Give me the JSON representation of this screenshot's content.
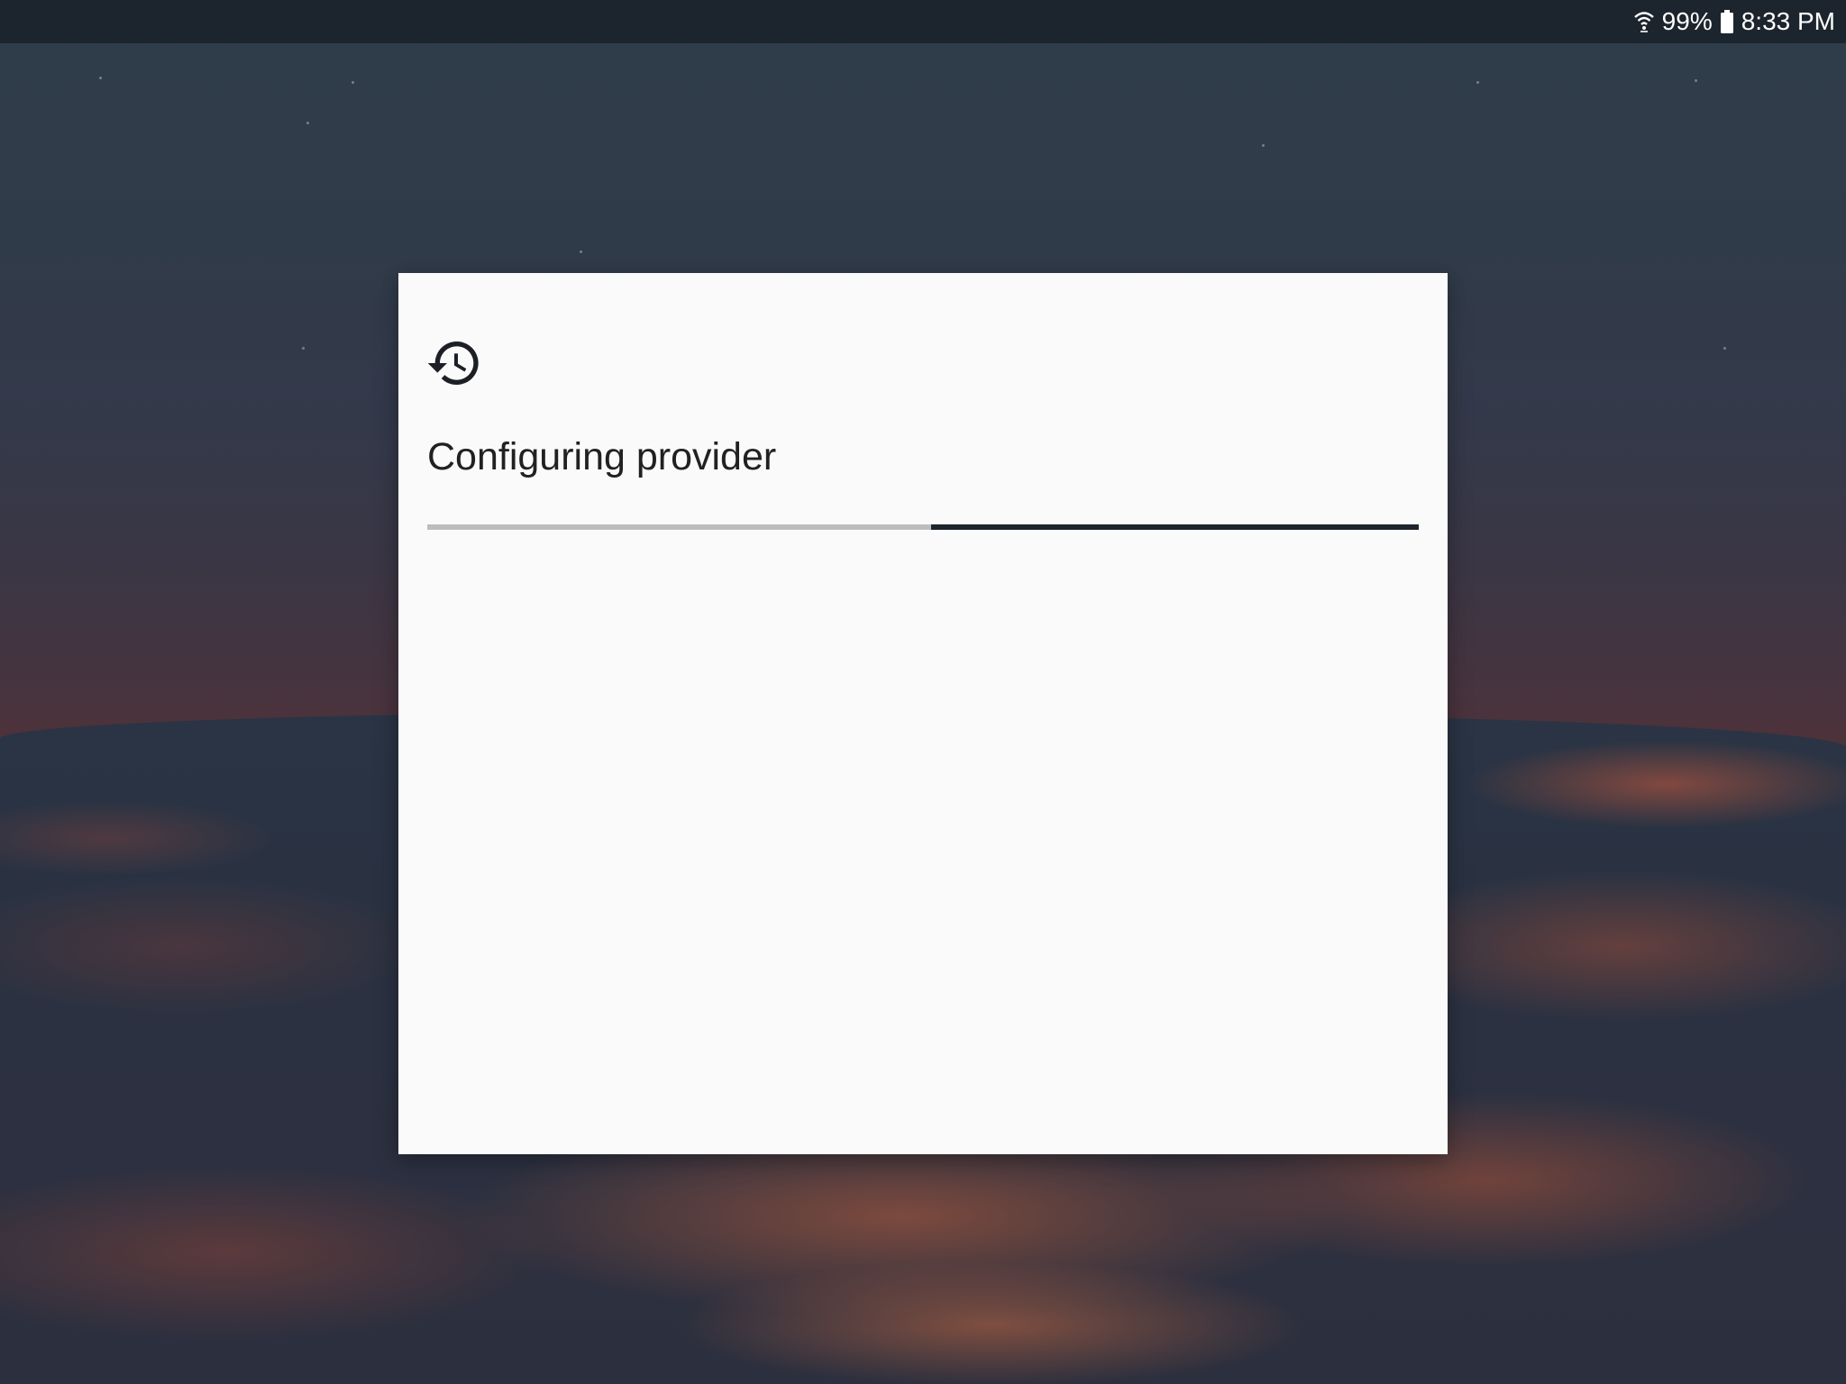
{
  "status_bar": {
    "wifi_icon": "wifi-icon",
    "battery_percent": "99%",
    "battery_icon": "battery-icon",
    "time": "8:33 PM"
  },
  "dialog": {
    "icon": "history-restore-icon",
    "title": "Configuring provider",
    "progress": {
      "type": "indeterminate",
      "indicator_start_fraction": 0.508,
      "indicator_end_fraction": 1.0,
      "track_color": "#bdbdbd",
      "indicator_color": "#1e242c"
    }
  },
  "colors": {
    "status_bar_bg": "#1c252d",
    "dialog_bg": "#fafafa",
    "text_primary": "#212121"
  }
}
